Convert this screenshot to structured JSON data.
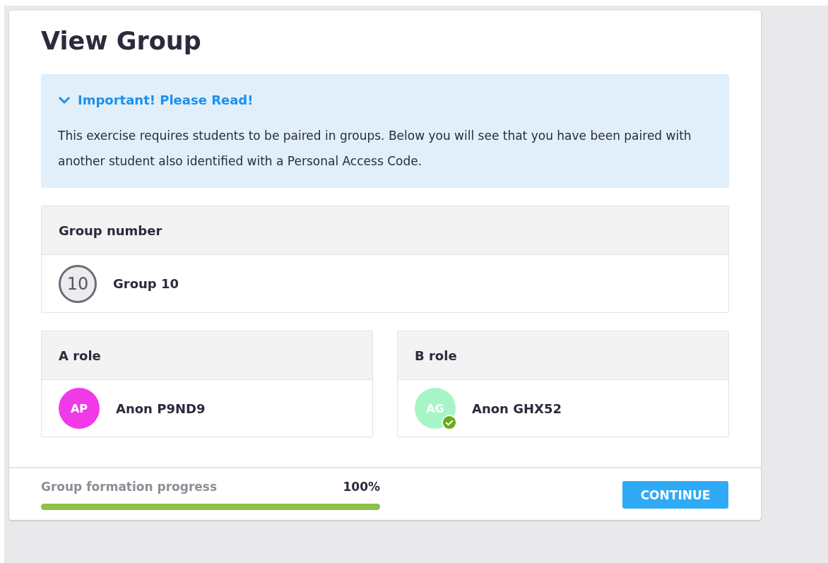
{
  "title": "View Group",
  "notice": {
    "heading": "Important! Please Read!",
    "expanded": true,
    "body": "This exercise requires students to be paired in groups. Below you will see that you have been paired with another student also identified with a Personal Access Code."
  },
  "group": {
    "heading": "Group number",
    "number": "10",
    "name": "Group 10"
  },
  "roles": [
    {
      "heading": "A role",
      "initials": "AP",
      "name": "Anon P9ND9",
      "color": "#f03ae8",
      "verified": false
    },
    {
      "heading": "B role",
      "initials": "AG",
      "name": "Anon GHX52",
      "color": "#a6f5c6",
      "verified": true
    }
  ],
  "progress": {
    "label": "Group formation progress",
    "reading": "100%",
    "level": 1
  },
  "button": "CONTINUE"
}
